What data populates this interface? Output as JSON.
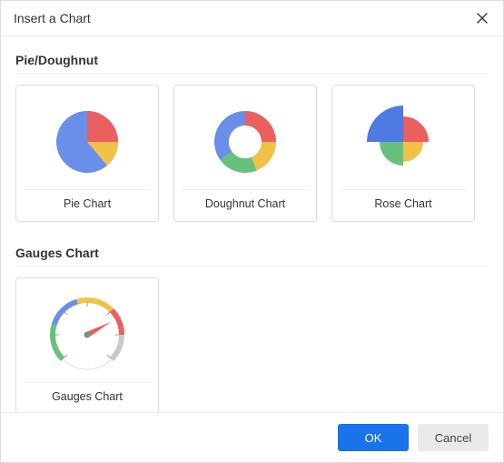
{
  "dialog": {
    "title": "Insert a Chart"
  },
  "sections": {
    "pie": {
      "title": "Pie/Doughnut",
      "items": [
        {
          "label": "Pie Chart"
        },
        {
          "label": "Doughnut Chart"
        },
        {
          "label": "Rose Chart"
        }
      ]
    },
    "gauges": {
      "title": "Gauges Chart",
      "items": [
        {
          "label": "Gauges Chart"
        }
      ]
    }
  },
  "footer": {
    "ok_label": "OK",
    "cancel_label": "Cancel"
  },
  "colors": {
    "blue": "#6a8fe8",
    "red": "#ea6060",
    "yellow": "#f0c24a",
    "green": "#66c27a",
    "accent_blue": "#4f79e3"
  }
}
